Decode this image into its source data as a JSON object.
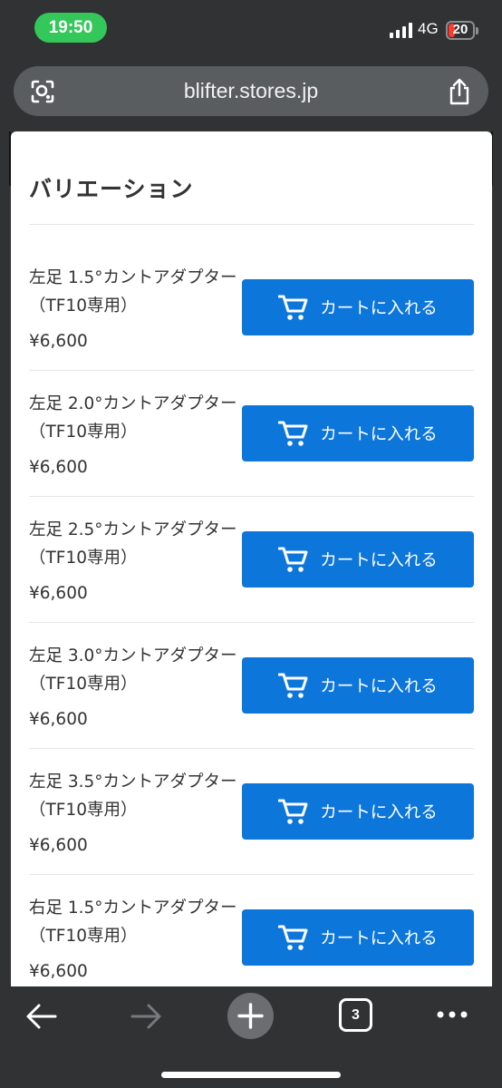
{
  "status_bar": {
    "time": "19:50",
    "network": "4G",
    "battery_level": "20"
  },
  "browser": {
    "url": "blifter.stores.jp",
    "open_tabs": "3"
  },
  "page": {
    "heading": "バリエーション",
    "cart_button_label": "カートに入れる",
    "variants": [
      {
        "title": "左足 1.5°カントアダプター（TF10専用）",
        "price": "¥6,600"
      },
      {
        "title": "左足 2.0°カントアダプター（TF10専用）",
        "price": "¥6,600"
      },
      {
        "title": "左足 2.5°カントアダプター（TF10専用）",
        "price": "¥6,600"
      },
      {
        "title": "左足 3.0°カントアダプター（TF10専用）",
        "price": "¥6,600"
      },
      {
        "title": "左足 3.5°カントアダプター（TF10専用）",
        "price": "¥6,600"
      },
      {
        "title": "右足 1.5°カントアダプター（TF10専用）",
        "price": "¥6,600"
      }
    ]
  },
  "colors": {
    "accent": "#0d76da",
    "chrome": "#303234",
    "text": "#333333"
  }
}
